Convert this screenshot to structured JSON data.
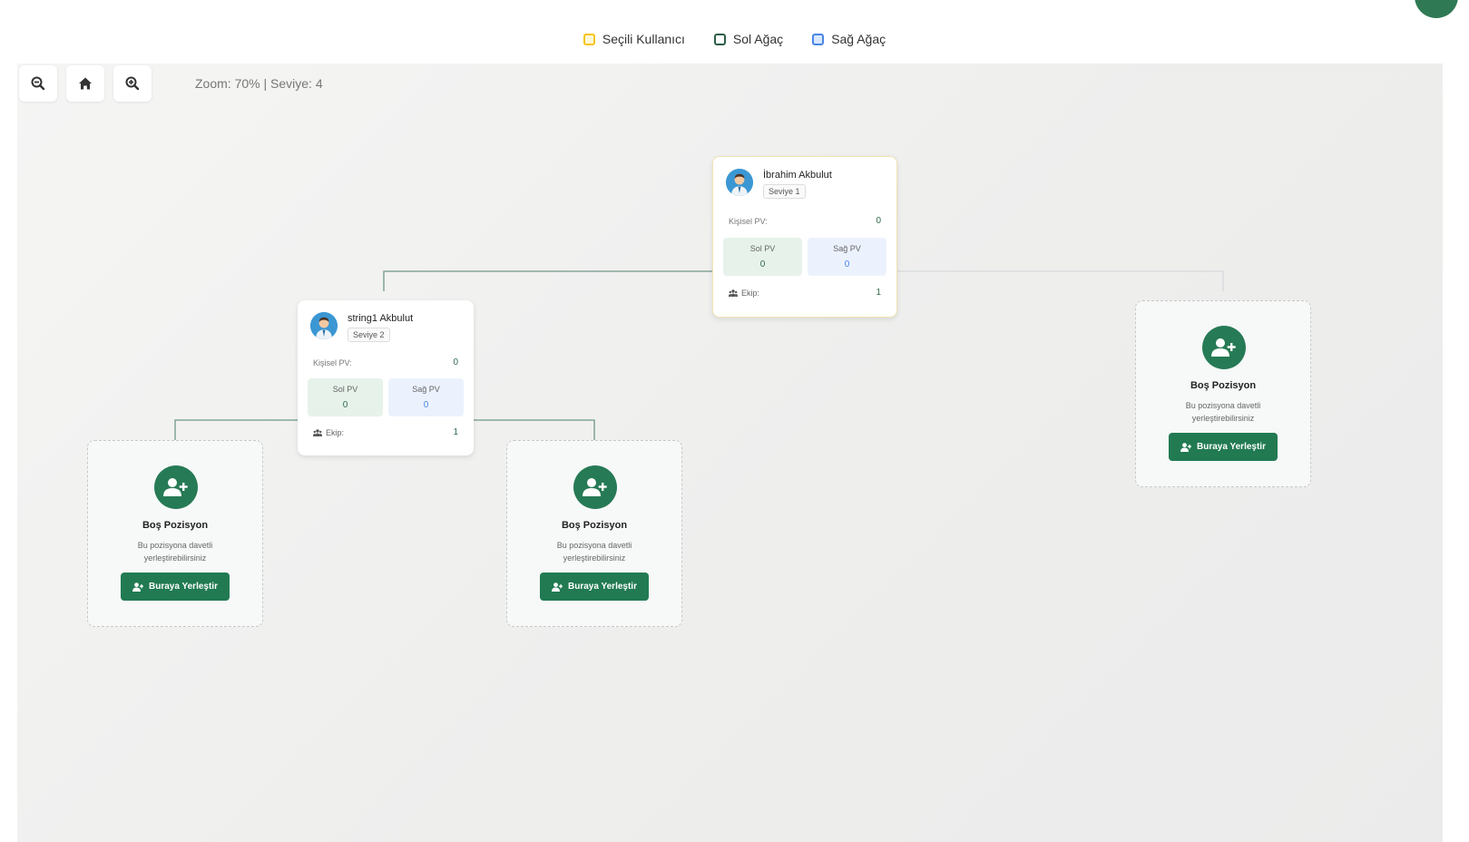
{
  "legend": [
    {
      "label": "Seçili Kullanıcı",
      "color": "#f5c518"
    },
    {
      "label": "Sol Ağaç",
      "color": "#2e5e46"
    },
    {
      "label": "Sağ Ağaç",
      "color": "#4a86e8"
    }
  ],
  "controls": {
    "zoom_out_icon": "zoom-out-icon",
    "home_icon": "home-icon",
    "zoom_in_icon": "zoom-in-icon",
    "zoom_label": "Zoom:",
    "zoom_value": "70%",
    "separator": "|",
    "level_label": "Seviye:",
    "level_value": "4"
  },
  "root": {
    "name": "İbrahim Akbulut",
    "level": "Seviye 1",
    "personal_pv_label": "Kişisel PV:",
    "personal_pv": "0",
    "left_pv_label": "Sol PV",
    "left_pv": "0",
    "right_pv_label": "Sağ PV",
    "right_pv": "0",
    "team_label": "Ekip:",
    "team": "1"
  },
  "child": {
    "name": "string1 Akbulut",
    "level": "Seviye 2",
    "personal_pv_label": "Kişisel PV:",
    "personal_pv": "0",
    "left_pv_label": "Sol PV",
    "left_pv": "0",
    "right_pv_label": "Sağ PV",
    "right_pv": "0",
    "team_label": "Ekip:",
    "team": "1"
  },
  "empty_slot": {
    "title": "Boş Pozisyon",
    "description": "Bu pozisyona davetli yerleştirebilirsiniz",
    "button": "Buraya Yerleştir"
  },
  "colors": {
    "accent": "#217a52",
    "selected": "#f5c518",
    "left_tree": "#2e5e46",
    "right_tree": "#4a86e8"
  }
}
